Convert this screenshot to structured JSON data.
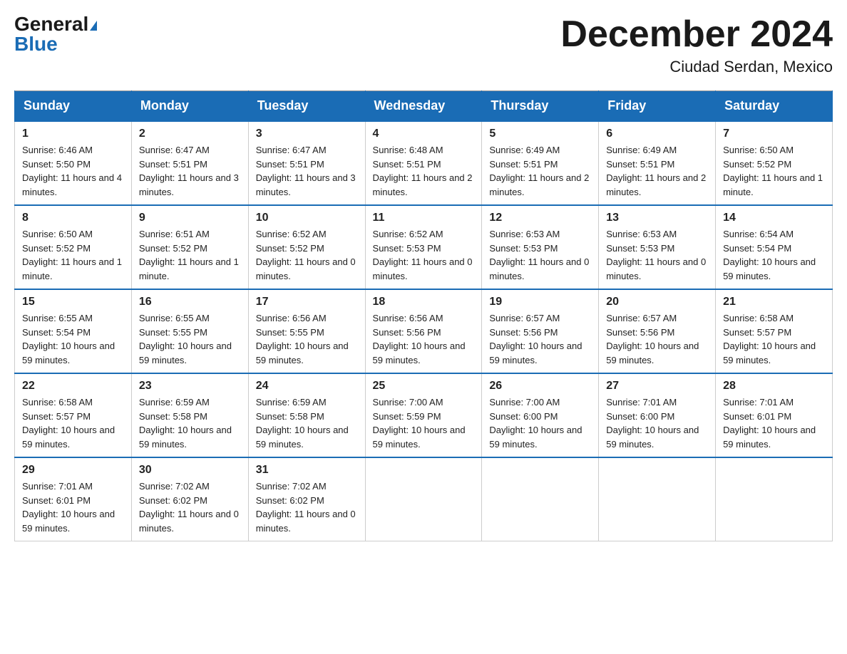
{
  "header": {
    "logo_general": "General",
    "logo_blue": "Blue",
    "month_title": "December 2024",
    "location": "Ciudad Serdan, Mexico"
  },
  "days_of_week": [
    "Sunday",
    "Monday",
    "Tuesday",
    "Wednesday",
    "Thursday",
    "Friday",
    "Saturday"
  ],
  "weeks": [
    [
      {
        "day": "1",
        "sunrise": "6:46 AM",
        "sunset": "5:50 PM",
        "daylight": "11 hours and 4 minutes."
      },
      {
        "day": "2",
        "sunrise": "6:47 AM",
        "sunset": "5:51 PM",
        "daylight": "11 hours and 3 minutes."
      },
      {
        "day": "3",
        "sunrise": "6:47 AM",
        "sunset": "5:51 PM",
        "daylight": "11 hours and 3 minutes."
      },
      {
        "day": "4",
        "sunrise": "6:48 AM",
        "sunset": "5:51 PM",
        "daylight": "11 hours and 2 minutes."
      },
      {
        "day": "5",
        "sunrise": "6:49 AM",
        "sunset": "5:51 PM",
        "daylight": "11 hours and 2 minutes."
      },
      {
        "day": "6",
        "sunrise": "6:49 AM",
        "sunset": "5:51 PM",
        "daylight": "11 hours and 2 minutes."
      },
      {
        "day": "7",
        "sunrise": "6:50 AM",
        "sunset": "5:52 PM",
        "daylight": "11 hours and 1 minute."
      }
    ],
    [
      {
        "day": "8",
        "sunrise": "6:50 AM",
        "sunset": "5:52 PM",
        "daylight": "11 hours and 1 minute."
      },
      {
        "day": "9",
        "sunrise": "6:51 AM",
        "sunset": "5:52 PM",
        "daylight": "11 hours and 1 minute."
      },
      {
        "day": "10",
        "sunrise": "6:52 AM",
        "sunset": "5:52 PM",
        "daylight": "11 hours and 0 minutes."
      },
      {
        "day": "11",
        "sunrise": "6:52 AM",
        "sunset": "5:53 PM",
        "daylight": "11 hours and 0 minutes."
      },
      {
        "day": "12",
        "sunrise": "6:53 AM",
        "sunset": "5:53 PM",
        "daylight": "11 hours and 0 minutes."
      },
      {
        "day": "13",
        "sunrise": "6:53 AM",
        "sunset": "5:53 PM",
        "daylight": "11 hours and 0 minutes."
      },
      {
        "day": "14",
        "sunrise": "6:54 AM",
        "sunset": "5:54 PM",
        "daylight": "10 hours and 59 minutes."
      }
    ],
    [
      {
        "day": "15",
        "sunrise": "6:55 AM",
        "sunset": "5:54 PM",
        "daylight": "10 hours and 59 minutes."
      },
      {
        "day": "16",
        "sunrise": "6:55 AM",
        "sunset": "5:55 PM",
        "daylight": "10 hours and 59 minutes."
      },
      {
        "day": "17",
        "sunrise": "6:56 AM",
        "sunset": "5:55 PM",
        "daylight": "10 hours and 59 minutes."
      },
      {
        "day": "18",
        "sunrise": "6:56 AM",
        "sunset": "5:56 PM",
        "daylight": "10 hours and 59 minutes."
      },
      {
        "day": "19",
        "sunrise": "6:57 AM",
        "sunset": "5:56 PM",
        "daylight": "10 hours and 59 minutes."
      },
      {
        "day": "20",
        "sunrise": "6:57 AM",
        "sunset": "5:56 PM",
        "daylight": "10 hours and 59 minutes."
      },
      {
        "day": "21",
        "sunrise": "6:58 AM",
        "sunset": "5:57 PM",
        "daylight": "10 hours and 59 minutes."
      }
    ],
    [
      {
        "day": "22",
        "sunrise": "6:58 AM",
        "sunset": "5:57 PM",
        "daylight": "10 hours and 59 minutes."
      },
      {
        "day": "23",
        "sunrise": "6:59 AM",
        "sunset": "5:58 PM",
        "daylight": "10 hours and 59 minutes."
      },
      {
        "day": "24",
        "sunrise": "6:59 AM",
        "sunset": "5:58 PM",
        "daylight": "10 hours and 59 minutes."
      },
      {
        "day": "25",
        "sunrise": "7:00 AM",
        "sunset": "5:59 PM",
        "daylight": "10 hours and 59 minutes."
      },
      {
        "day": "26",
        "sunrise": "7:00 AM",
        "sunset": "6:00 PM",
        "daylight": "10 hours and 59 minutes."
      },
      {
        "day": "27",
        "sunrise": "7:01 AM",
        "sunset": "6:00 PM",
        "daylight": "10 hours and 59 minutes."
      },
      {
        "day": "28",
        "sunrise": "7:01 AM",
        "sunset": "6:01 PM",
        "daylight": "10 hours and 59 minutes."
      }
    ],
    [
      {
        "day": "29",
        "sunrise": "7:01 AM",
        "sunset": "6:01 PM",
        "daylight": "10 hours and 59 minutes."
      },
      {
        "day": "30",
        "sunrise": "7:02 AM",
        "sunset": "6:02 PM",
        "daylight": "11 hours and 0 minutes."
      },
      {
        "day": "31",
        "sunrise": "7:02 AM",
        "sunset": "6:02 PM",
        "daylight": "11 hours and 0 minutes."
      },
      null,
      null,
      null,
      null
    ]
  ],
  "labels": {
    "sunrise": "Sunrise:",
    "sunset": "Sunset:",
    "daylight": "Daylight:"
  }
}
